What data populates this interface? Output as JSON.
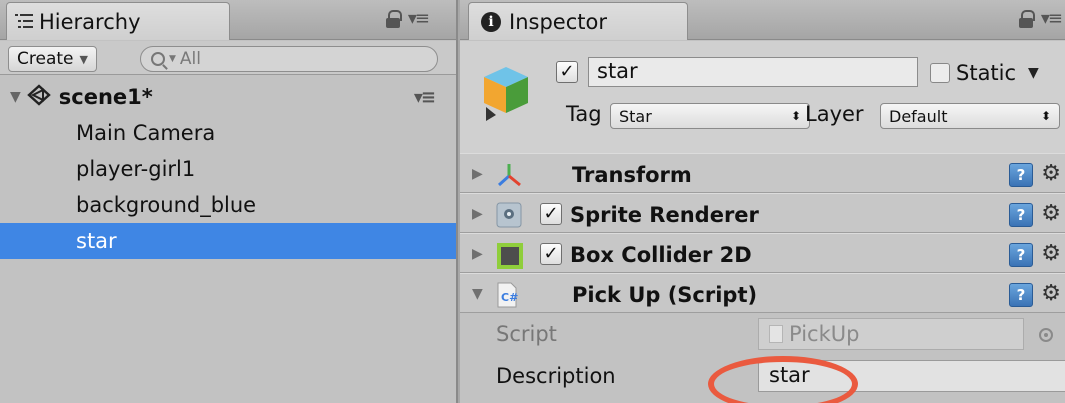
{
  "hierarchy": {
    "tab_icon": "list-icon",
    "title": "Hierarchy",
    "create_label": "Create",
    "search_placeholder": "All",
    "scene_name": "scene1*",
    "items": [
      {
        "label": "Main Camera",
        "selected": false
      },
      {
        "label": "player-girl1",
        "selected": false
      },
      {
        "label": "background_blue",
        "selected": false
      },
      {
        "label": "star",
        "selected": true
      }
    ]
  },
  "inspector": {
    "tab_icon": "info-icon",
    "title": "Inspector",
    "info_glyph": "i",
    "object": {
      "active": true,
      "name": "star",
      "static_label": "Static",
      "static_checked": false,
      "tag_label": "Tag",
      "tag_value": "Star",
      "layer_label": "Layer",
      "layer_value": "Default"
    },
    "components": [
      {
        "name": "Transform",
        "icon": "transform-axes-icon",
        "has_checkbox": false,
        "expanded": false
      },
      {
        "name": "Sprite Renderer",
        "icon": "sprite-renderer-icon",
        "has_checkbox": true,
        "enabled": true,
        "expanded": false
      },
      {
        "name": "Box Collider 2D",
        "icon": "box-collider-icon",
        "has_checkbox": true,
        "enabled": true,
        "expanded": false
      },
      {
        "name": "Pick Up (Script)",
        "icon": "csharp-script-icon",
        "has_checkbox": false,
        "expanded": true
      }
    ],
    "script_props": {
      "script_label": "Script",
      "script_value": "PickUp",
      "description_label": "Description",
      "description_value": "star"
    }
  },
  "colors": {
    "selection": "#3f86e4",
    "highlight_ring": "#ea5a3f"
  }
}
